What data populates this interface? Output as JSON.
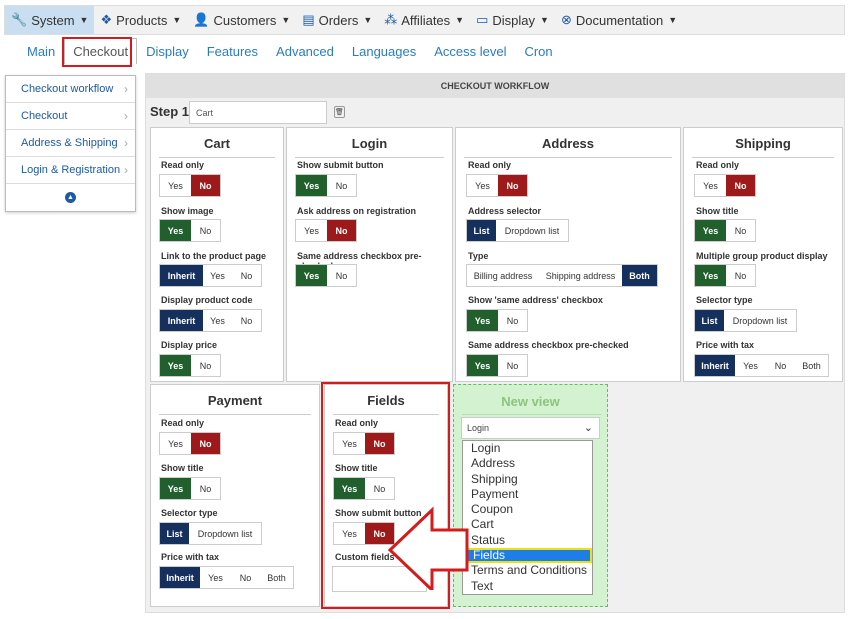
{
  "topnav": [
    {
      "label": "System",
      "icon": "wrench-icon",
      "glyph": "🔧",
      "active": true
    },
    {
      "label": "Products",
      "icon": "cubes-icon",
      "glyph": "❖",
      "active": false
    },
    {
      "label": "Customers",
      "icon": "user-icon",
      "glyph": "👤",
      "active": false
    },
    {
      "label": "Orders",
      "icon": "list-icon",
      "glyph": "▤",
      "active": false
    },
    {
      "label": "Affiliates",
      "icon": "users-icon",
      "glyph": "⁂",
      "active": false
    },
    {
      "label": "Display",
      "icon": "desktop-icon",
      "glyph": "▭",
      "active": false
    },
    {
      "label": "Documentation",
      "icon": "lifebuoy-icon",
      "glyph": "⊗",
      "active": false
    }
  ],
  "subnav": [
    "Main",
    "Checkout",
    "Display",
    "Features",
    "Advanced",
    "Languages",
    "Access level",
    "Cron"
  ],
  "subnav_selected": "Checkout",
  "sidebar": {
    "items": [
      "Checkout workflow",
      "Checkout",
      "Address & Shipping",
      "Login & Registration"
    ],
    "collapse_icon": "chevron-up-circle-icon"
  },
  "workflow": {
    "header": "CHECKOUT WORKFLOW",
    "step_label": "Step 1",
    "step_placeholder": "Cart",
    "trash_icon": "trash-icon"
  },
  "views": {
    "cart": {
      "title": "Cart"
    },
    "login": {
      "title": "Login"
    },
    "address": {
      "title": "Address"
    },
    "shipping": {
      "title": "Shipping"
    },
    "payment": {
      "title": "Payment"
    },
    "fields": {
      "title": "Fields",
      "custom_fields_label": "Custom fields"
    }
  },
  "options": {
    "read_only": "Read only",
    "show_image": "Show image",
    "link_product": "Link to the product page",
    "display_code": "Display product code",
    "display_price": "Display price",
    "show_submit": "Show submit button",
    "ask_address": "Ask address on registration",
    "same_address_pre": "Same address checkbox pre-checked",
    "address_selector": "Address selector",
    "type": "Type",
    "show_same_address": "Show 'same address' checkbox",
    "show_title": "Show title",
    "multiple_group": "Multiple group product display",
    "selector_type": "Selector type",
    "price_with_tax": "Price with tax"
  },
  "buttons": {
    "yes": "Yes",
    "no": "No",
    "inherit": "Inherit",
    "both": "Both",
    "list": "List",
    "dropdown_list": "Dropdown list",
    "billing_address": "Billing address",
    "shipping_address": "Shipping address"
  },
  "new_view": {
    "title": "New view",
    "selected": "Login",
    "options": [
      "Login",
      "Address",
      "Shipping",
      "Payment",
      "Coupon",
      "Cart",
      "Status",
      "Fields",
      "Terms and Conditions",
      "Text"
    ],
    "highlighted": "Fields"
  },
  "colors": {
    "no_active": "#9e1a1a",
    "yes_active": "#21602d",
    "blue_active": "#16305e",
    "link": "#2a7bc4",
    "annotation_red": "#d51b1b",
    "highlight_yellow": "#e8e20e"
  }
}
